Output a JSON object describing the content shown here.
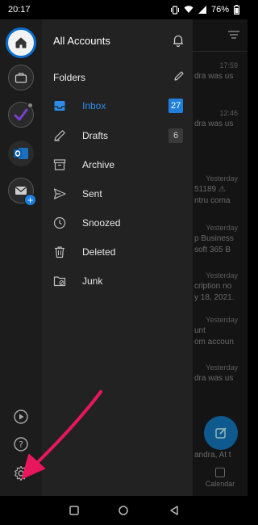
{
  "status": {
    "time": "20:17",
    "battery": "76%",
    "icons": [
      "vibrate-icon",
      "wifi-icon",
      "signal-icon",
      "battery-icon"
    ]
  },
  "drawer": {
    "title": "All Accounts",
    "folders_label": "Folders",
    "folders": [
      {
        "label": "Inbox",
        "icon": "inbox-icon",
        "count": "27",
        "active": true
      },
      {
        "label": "Drafts",
        "icon": "drafts-icon",
        "count": "6",
        "active": false
      },
      {
        "label": "Archive",
        "icon": "archive-icon",
        "count": "",
        "active": false
      },
      {
        "label": "Sent",
        "icon": "sent-icon",
        "count": "",
        "active": false
      },
      {
        "label": "Snoozed",
        "icon": "clock-icon",
        "count": "",
        "active": false
      },
      {
        "label": "Deleted",
        "icon": "trash-icon",
        "count": "",
        "active": false
      },
      {
        "label": "Junk",
        "icon": "junk-folder-icon",
        "count": "",
        "active": false
      }
    ]
  },
  "rail": {
    "items": [
      "home-icon",
      "briefcase-icon",
      "checkmark-account-icon",
      "outlook-icon",
      "add-account-icon"
    ],
    "bottom": [
      "play-icon",
      "help-icon",
      "settings-icon"
    ]
  },
  "background_list": {
    "rows": [
      {
        "time": "17:59",
        "text": "dra was us"
      },
      {
        "time": "12:46",
        "text": "dra was us"
      },
      {
        "time": "Yesterday",
        "text": "51189 ⚠",
        "text2": "ntru coma"
      },
      {
        "time": "Yesterday",
        "text": "p Business",
        "text2": "soft 365 B"
      },
      {
        "time": "Yesterday",
        "text": "cription no",
        "text2": "y 18, 2021."
      },
      {
        "time": "Yesterday",
        "text": "unt",
        "text2": "om accoun"
      },
      {
        "time": "Yesterday",
        "text": "dra was us"
      },
      {
        "time": "",
        "text": "andra, At t"
      }
    ],
    "calendar_label": "Calendar"
  },
  "colors": {
    "accent": "#1f7fdb",
    "arrow": "#e8175d",
    "drawer_bg": "#222222"
  }
}
